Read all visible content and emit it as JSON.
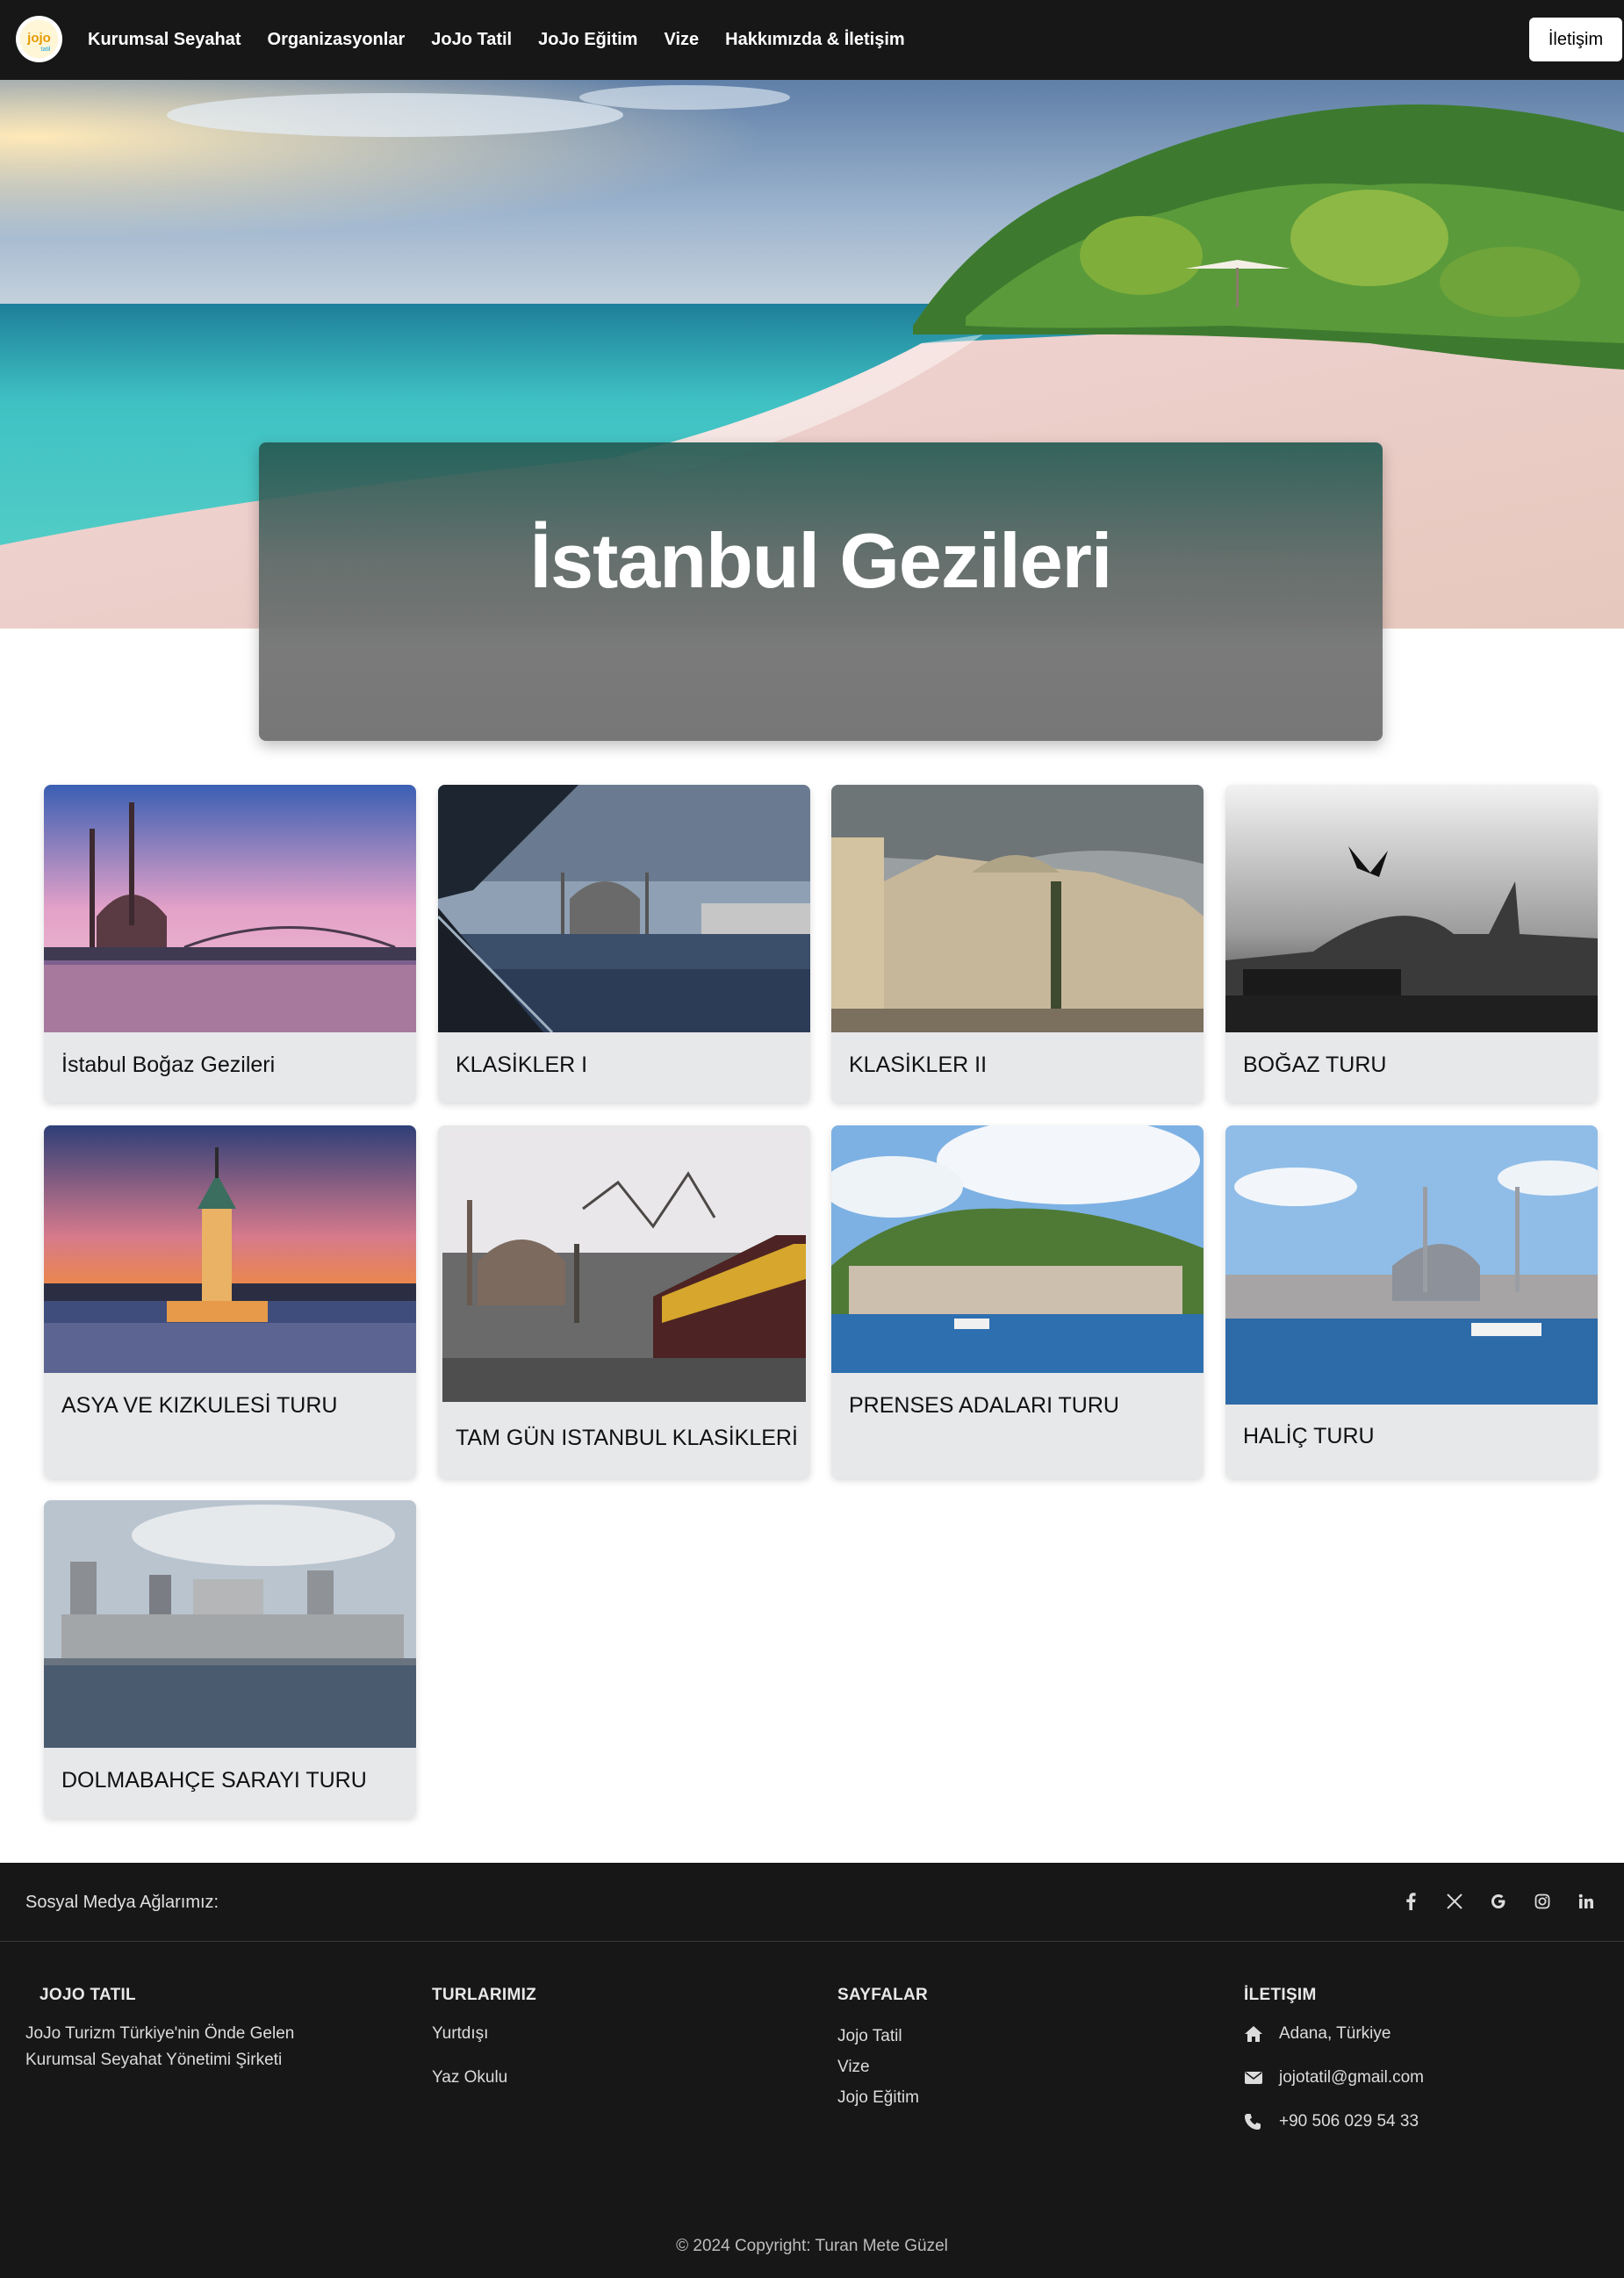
{
  "nav": {
    "logo_text": "jojo",
    "links": [
      "Kurumsal Seyahat",
      "Organizasyonlar",
      "JoJo Tatil",
      "JoJo Eğitim",
      "Vize",
      "Hakkımızda & İletişim"
    ],
    "contact_button": "İletişim"
  },
  "hero": {
    "title": "İstanbul Gezileri"
  },
  "tours": [
    {
      "label": "İstabul Boğaz Gezileri"
    },
    {
      "label": "KLASİKLER I"
    },
    {
      "label": "KLASİKLER II"
    },
    {
      "label": "BOĞAZ TURU"
    },
    {
      "label": "ASYA VE KIZKULESİ TURU"
    },
    {
      "label": "TAM GÜN ISTANBUL KLASİKLERİ"
    },
    {
      "label": "PRENSES ADALARI TURU"
    },
    {
      "label": "HALİÇ TURU"
    },
    {
      "label": "DOLMABAHÇE SARAYI TURU"
    }
  ],
  "footer": {
    "social_text": "Sosyal Medya Ağlarımız:",
    "social_icons": [
      "facebook-icon",
      "x-icon",
      "google-icon",
      "instagram-icon",
      "linkedin-icon"
    ],
    "col1": {
      "heading": "JOJO TATIL",
      "text": "JoJo Turizm Türkiye'nin Önde Gelen Kurumsal Seyahat Yönetimi Şirketi"
    },
    "col2": {
      "heading": "TURLARIMIZ",
      "items": [
        "Yurtdışı",
        "Yaz Okulu"
      ]
    },
    "col3": {
      "heading": "SAYFALAR",
      "items": [
        "Jojo Tatil",
        "Vize",
        "Jojo Eğitim"
      ]
    },
    "col4": {
      "heading": "İLETIŞIM",
      "address": "Adana, Türkiye",
      "email": "jojotatil@gmail.com",
      "phone": "+90 506 029 54 33"
    },
    "copyright": "© 2024 Copyright: Turan Mete Güzel"
  }
}
